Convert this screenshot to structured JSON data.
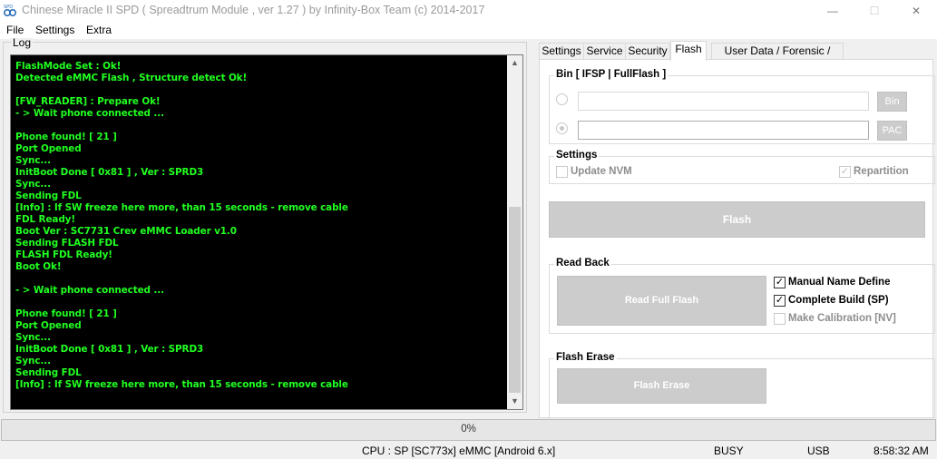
{
  "window": {
    "title": "Chinese Miracle II SPD ( Spreadtrum Module , ver 1.27 ) by Infinity-Box Team (c) 2014-2017",
    "minimize_glyph": "—",
    "maximize_glyph": "☐",
    "close_glyph": "✕"
  },
  "menu": [
    "File",
    "Settings",
    "Extra"
  ],
  "log": {
    "title": "Log",
    "lines": [
      "FlashMode Set : Ok!",
      "Detected eMMC Flash , Structure detect Ok!",
      "",
      "[FW_READER] : Prepare Ok!",
      "- > Wait phone connected ...",
      "",
      "Phone found! [ 21 ]",
      "Port Opened",
      "Sync...",
      "InitBoot Done [ 0x81 ] , Ver : SPRD3",
      "Sync...",
      "Sending FDL",
      "[Info] : If SW freeze here more, than 15 seconds - remove cable",
      "FDL Ready!",
      "Boot Ver : SC7731 Crev eMMC Loader v1.0",
      "Sending FLASH FDL",
      "FLASH FDL Ready!",
      "Boot Ok!",
      "",
      "- > Wait phone connected ...",
      "",
      "Phone found! [ 21 ]",
      "Port Opened",
      "Sync...",
      "InitBoot Done [ 0x81 ] , Ver : SPRD3",
      "Sync...",
      "Sending FDL",
      "[Info] : If SW freeze here more, than 15 seconds - remove cable"
    ],
    "text_color": "#21ff21",
    "background": "#000000"
  },
  "tabs": [
    {
      "label": "Settings",
      "active": false
    },
    {
      "label": "Service",
      "active": false
    },
    {
      "label": "Security",
      "active": false
    },
    {
      "label": "Flash",
      "active": true
    },
    {
      "label": "User Data / Forensic / Other",
      "active": false
    }
  ],
  "flash": {
    "bin_group_label": "Bin  [ IFSP | FullFlash ]",
    "bin_input_value": "",
    "bin_button": "Bin",
    "pac_input_value": "",
    "pac_button": "PAC",
    "settings_group_label": "Settings",
    "update_nvm": {
      "label": "Update NVM",
      "checked": false
    },
    "repartition": {
      "label": "Repartition",
      "checked": true
    },
    "flash_button": "Flash",
    "readback_group_label": "Read Back",
    "read_full_flash_button": "Read Full Flash",
    "manual_name_define": {
      "label": "Manual Name Define",
      "checked": true
    },
    "complete_build": {
      "label": "Complete Build (SP)",
      "checked": true
    },
    "make_calibration": {
      "label": "Make Calibration [NV]",
      "checked": false
    },
    "flash_erase_group_label": "Flash Erase",
    "flash_erase_button": "Flash Erase"
  },
  "progress": {
    "value_percent": 0,
    "label": "0%"
  },
  "status": {
    "cpu": "CPU : SP [SC773x] eMMC [Android 6.x]",
    "state": "BUSY",
    "port": "USB",
    "time": "8:58:32 AM"
  },
  "icons": {
    "check": "✓",
    "scroll_up": "▲",
    "scroll_down": "▼"
  }
}
